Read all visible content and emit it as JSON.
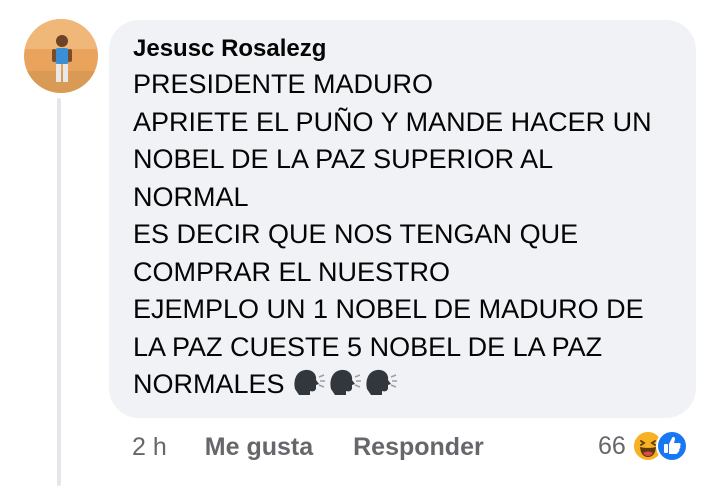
{
  "comment": {
    "author": "Jesusc Rosalezg",
    "lines": [
      "PRESIDENTE MADURO",
      "APRIETE EL PUÑO Y MANDE HACER UN",
      "NOBEL DE LA PAZ SUPERIOR AL",
      "NORMAL",
      "ES DECIR QUE NOS TENGAN QUE",
      "COMPRAR EL NUESTRO",
      "EJEMPLO UN 1 NOBEL DE MADURO DE",
      "LA PAZ CUESTE 5 NOBEL DE LA PAZ",
      "NORMALES"
    ],
    "trailing_emojis": [
      "speaking-head-icon",
      "speaking-head-icon",
      "speaking-head-icon"
    ]
  },
  "actions": {
    "time": "2 h",
    "like_label": "Me gusta",
    "reply_label": "Responder"
  },
  "reactions": {
    "count": "66",
    "icons": [
      "haha-reaction-icon",
      "like-reaction-icon"
    ]
  },
  "colors": {
    "bubble": "#f0f2f5",
    "secondary_text": "#65676b",
    "like_blue": "#1877f2",
    "haha_yellow": "#f7b125"
  }
}
